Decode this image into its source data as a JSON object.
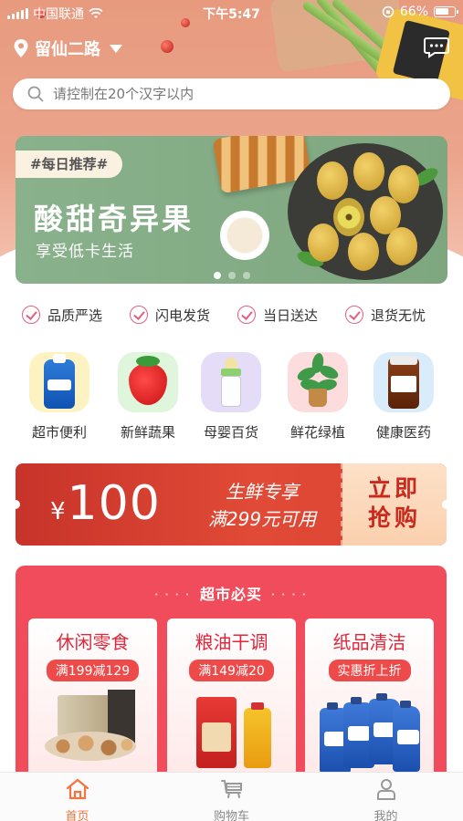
{
  "status_bar": {
    "carrier": "中国联通",
    "time": "下午5:47",
    "battery": "66%"
  },
  "header": {
    "location": "留仙二路",
    "search_placeholder": "请控制在20个汉字以内"
  },
  "banner": {
    "tag": "#每日推荐#",
    "title": "酸甜奇异果",
    "subtitle": "享受低卡生活",
    "slide_count": 3,
    "active_slide": 0
  },
  "features": [
    {
      "label": "品质严选"
    },
    {
      "label": "闪电发货"
    },
    {
      "label": "当日送达"
    },
    {
      "label": "退货无忧"
    }
  ],
  "categories": [
    {
      "label": "超市便利",
      "icon": "detergent-icon",
      "tile_color": "#fdf3c2"
    },
    {
      "label": "新鲜蔬果",
      "icon": "strawberry-icon",
      "tile_color": "#dff5dc"
    },
    {
      "label": "母婴百货",
      "icon": "baby-bottle-icon",
      "tile_color": "#e5dcf8"
    },
    {
      "label": "鲜花绿植",
      "icon": "plant-icon",
      "tile_color": "#fcdcdc"
    },
    {
      "label": "健康医药",
      "icon": "vitamin-bottle-icon",
      "tile_color": "#d9ecfb"
    }
  ],
  "coupon": {
    "currency": "¥",
    "amount": "100",
    "line1": "生鲜专享",
    "line2": "满299元可用",
    "button_line1": "立即",
    "button_line2": "抢购"
  },
  "market": {
    "title": "超市必买",
    "cards": [
      {
        "title": "休闲零食",
        "badge": "满199减129"
      },
      {
        "title": "粮油干调",
        "badge": "满149减20"
      },
      {
        "title": "纸品清洁",
        "badge": "实惠折上折"
      }
    ]
  },
  "tabbar": {
    "tabs": [
      {
        "label": "首页",
        "icon": "home-icon",
        "active": true
      },
      {
        "label": "购物车",
        "icon": "cart-icon",
        "active": false
      },
      {
        "label": "我的",
        "icon": "user-icon",
        "active": false
      }
    ]
  },
  "colors": {
    "accent": "#f27440",
    "coupon_red": "#d8402f",
    "market_red": "#f14c5b",
    "check_pink": "#e06080",
    "banner_green": "#89b18b"
  }
}
